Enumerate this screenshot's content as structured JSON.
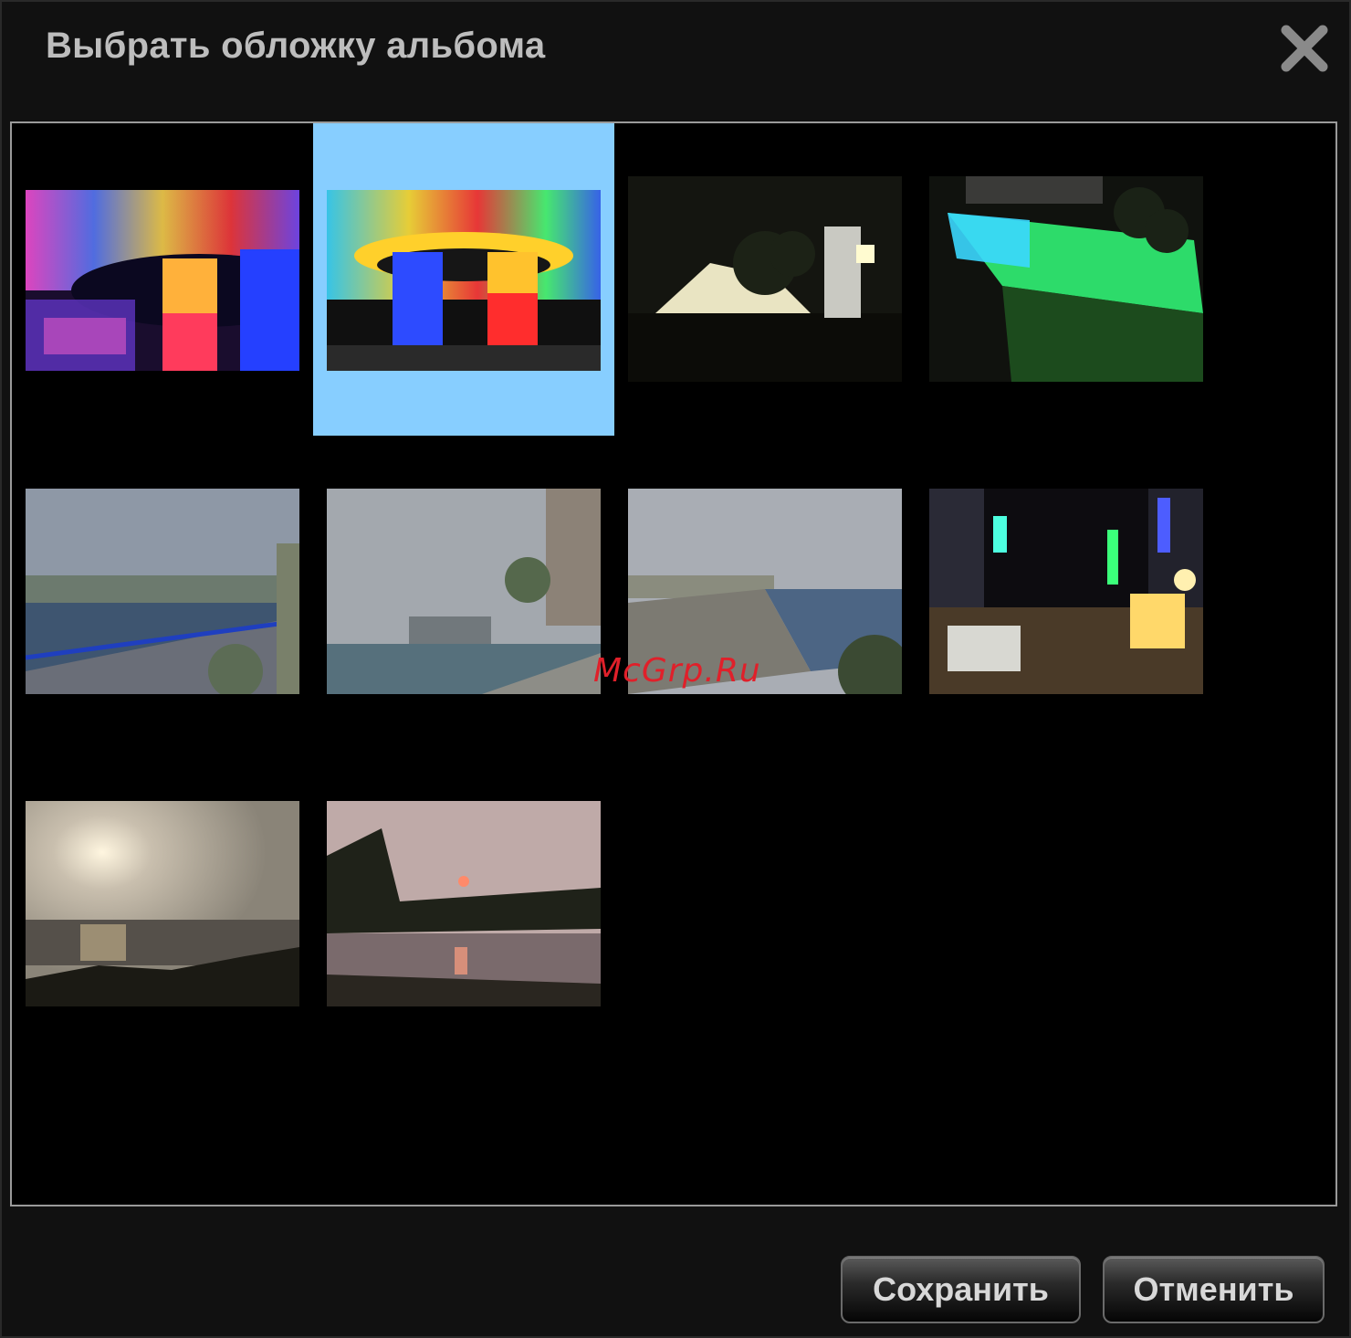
{
  "dialog": {
    "title": "Выбрать обложку альбома",
    "close_icon": "close-icon"
  },
  "gallery": {
    "selected_index": 1,
    "photos": [
      {
        "name": "photo-dome-of-light-1",
        "scene": "colorful stained glass dome, night"
      },
      {
        "name": "photo-dome-of-light-2",
        "scene": "colorful stained glass dome with columns"
      },
      {
        "name": "photo-night-pavilion",
        "scene": "night plaza with white tent structure"
      },
      {
        "name": "photo-lit-pool",
        "scene": "green and blue lit fountain pool at night"
      },
      {
        "name": "photo-harbor-promenade",
        "scene": "harbor promenade with blue railing"
      },
      {
        "name": "photo-river-city",
        "scene": "river with city skyline and tower"
      },
      {
        "name": "photo-beach-coast",
        "scene": "coastline with waves at dusk"
      },
      {
        "name": "photo-night-market",
        "scene": "night market street with neon signs"
      },
      {
        "name": "photo-sunset-sea",
        "scene": "hazy sunset over the sea"
      },
      {
        "name": "photo-sunset-lake",
        "scene": "sunset reflected in lake with trees"
      }
    ]
  },
  "watermark": "McGrp.Ru",
  "buttons": {
    "save_label": "Сохранить",
    "cancel_label": "Отменить"
  },
  "colors": {
    "selection": "#87ceff",
    "panel_border": "#9a9a9a",
    "background": "#111111"
  }
}
